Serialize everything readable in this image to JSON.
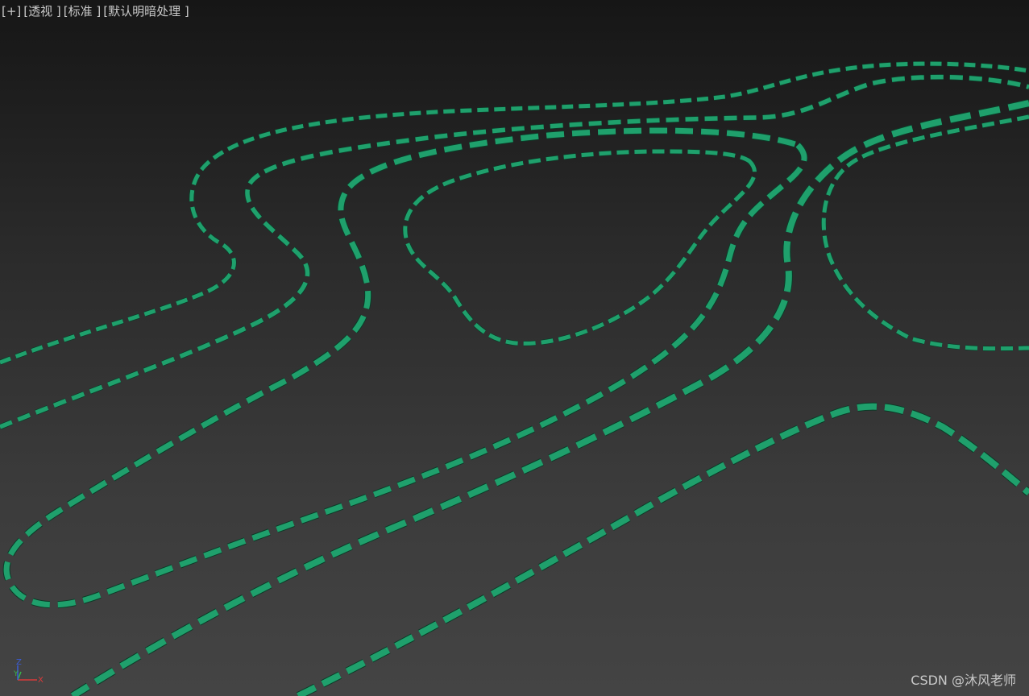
{
  "viewport": {
    "labels": {
      "plus": "[+]",
      "view_mode": "[透视 ]",
      "shading_standard": "[标准 ]",
      "shading_mode": "[默认明暗处理 ]"
    },
    "gizmo": {
      "z_label": "Z",
      "y_label": "Y",
      "x_label": "X",
      "x_color": "#d83a3a",
      "y_color": "#39b54a",
      "z_color": "#3a5cd8"
    },
    "spline_color": "#1fa06c",
    "spline_highlight": "#2fc48a",
    "watermark": "CSDN @沐风老师"
  }
}
